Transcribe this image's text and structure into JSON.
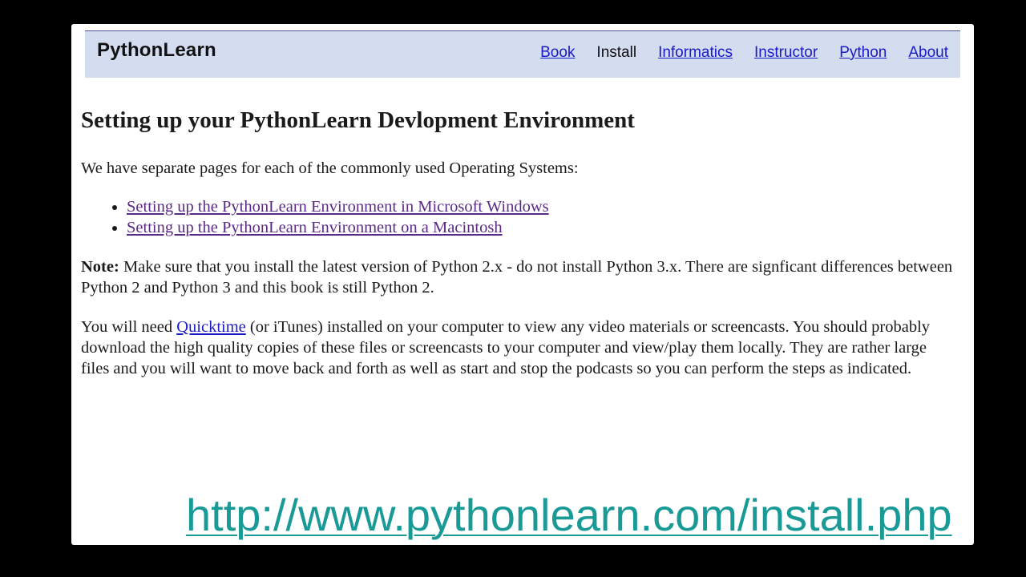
{
  "header": {
    "brand": "PythonLearn",
    "nav": [
      {
        "label": "Book",
        "current": false
      },
      {
        "label": "Install",
        "current": true
      },
      {
        "label": "Informatics",
        "current": false
      },
      {
        "label": "Instructor",
        "current": false
      },
      {
        "label": "Python",
        "current": false
      },
      {
        "label": "About",
        "current": false
      }
    ]
  },
  "main": {
    "title": "Setting up your PythonLearn Devlopment Environment",
    "intro": "We have separate pages for each of the commonly used Operating Systems:",
    "os_links": [
      "Setting up the PythonLearn Environment in Microsoft Windows",
      "Setting up the PythonLearn Environment on a Macintosh"
    ],
    "note_label": "Note:",
    "note_text": " Make sure that you install the latest version of Python 2.x - do not install Python 3.x. There are signficant differences between Python 2 and Python 3 and this book is still Python 2.",
    "video_pre": "You will need ",
    "video_link": "Quicktime",
    "video_post": " (or iTunes) installed on your computer to view any video materials or screencasts. You should probably download the high quality copies of these files or screencasts to your computer and view/play them locally. They are rather large files and you will want to move back and forth as well as start and stop the podcasts so you can perform the steps as indicated."
  },
  "footer_url": "http://www.pythonlearn.com/install.php",
  "colors": {
    "header_bg": "#d4dcf0",
    "nav_link": "#1a1ac8",
    "visited_link": "#5a2a86",
    "url_teal": "#1a9a96"
  }
}
